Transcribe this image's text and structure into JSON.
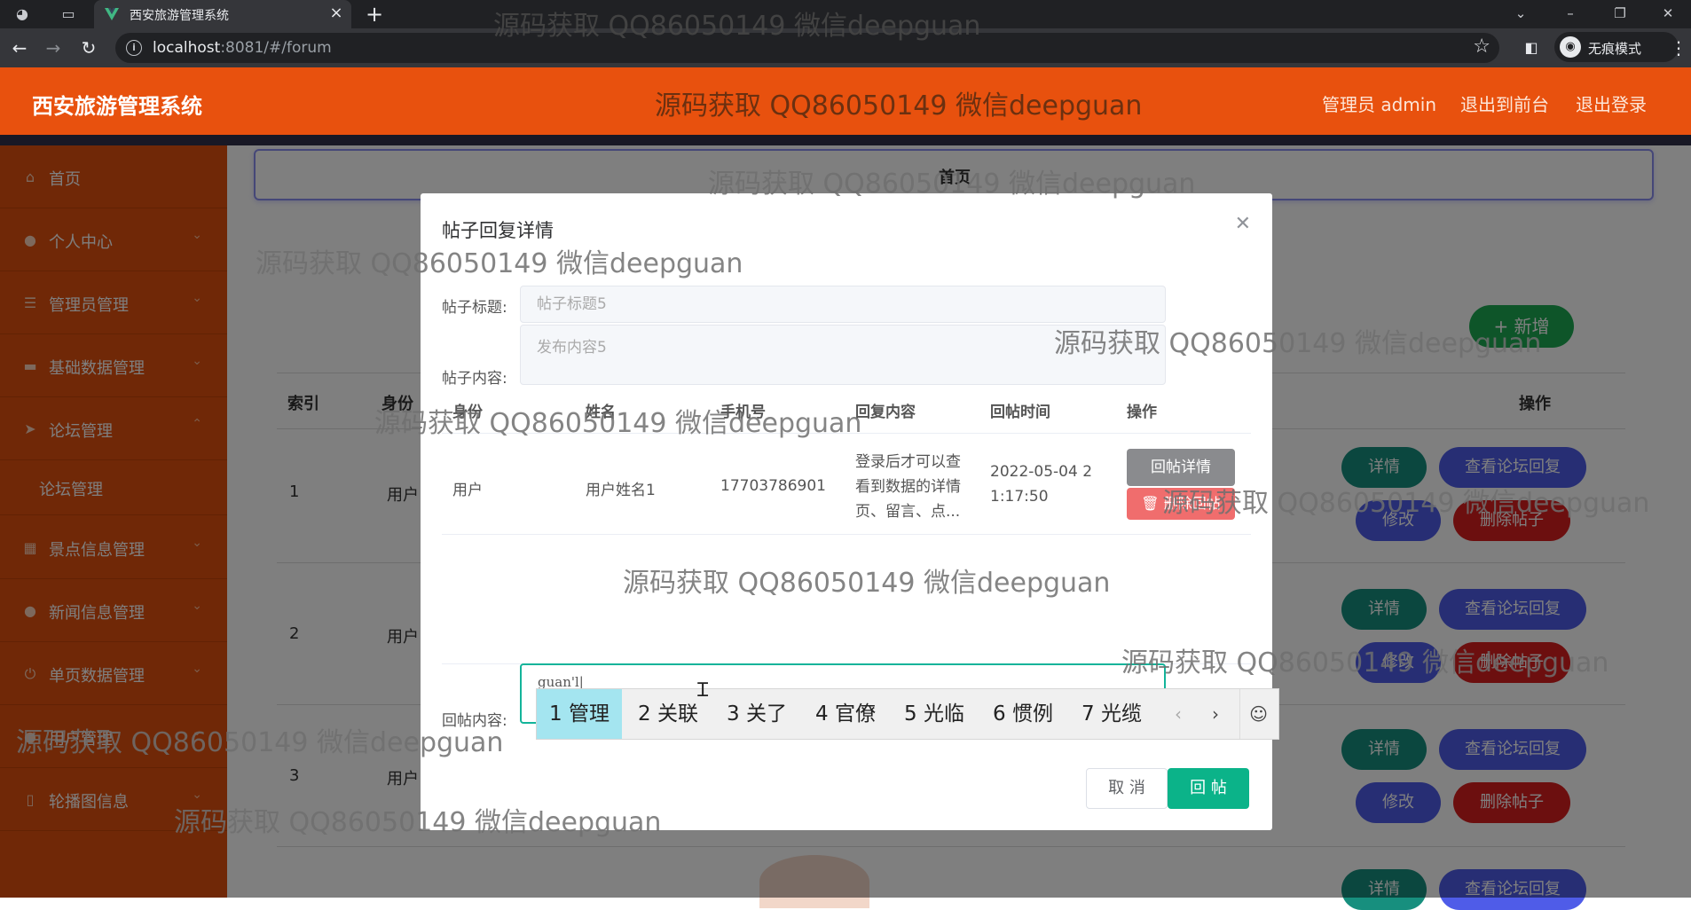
{
  "browser": {
    "tab_title": "西安旅游管理系统",
    "url_host": "localhost",
    "url_rest": ":8081/#/forum",
    "incognito_label": "无痕模式"
  },
  "header": {
    "app_title": "西安旅游管理系统",
    "watermark": "源码获取 QQ86050149 微信deepguan",
    "admin_label": "管理员 admin",
    "exit_front_label": "退出到前台",
    "logout_label": "退出登录"
  },
  "sidebar": {
    "items": [
      {
        "label": "首页",
        "icon": "home-icon"
      },
      {
        "label": "个人中心",
        "icon": "user-icon"
      },
      {
        "label": "管理员管理",
        "icon": "list-icon"
      },
      {
        "label": "基础数据管理",
        "icon": "database-icon"
      },
      {
        "label": "论坛管理",
        "icon": "send-icon"
      },
      {
        "label": "论坛管理",
        "icon": ""
      },
      {
        "label": "景点信息管理",
        "icon": "grid-icon"
      },
      {
        "label": "新闻信息管理",
        "icon": "user-icon"
      },
      {
        "label": "单页数据管理",
        "icon": "power-icon"
      },
      {
        "label": "用户管理",
        "icon": "user-icon"
      },
      {
        "label": "轮播图信息",
        "icon": "phone-icon"
      }
    ]
  },
  "main": {
    "breadcrumb": "首页",
    "add_button": "+ 新增",
    "columns": [
      "索引",
      "身份",
      "操作"
    ],
    "rows": [
      {
        "index": "1",
        "identity": "用户"
      },
      {
        "index": "2",
        "identity": "用户"
      },
      {
        "index": "3",
        "identity": "用户"
      }
    ],
    "actions": {
      "detail": "详情",
      "view_replies": "查看论坛回复",
      "edit": "修改",
      "delete": "删除帖子"
    }
  },
  "dialog": {
    "title": "帖子回复详情",
    "post_title_label": "帖子标题:",
    "post_title_value": "帖子标题5",
    "post_content_label": "帖子内容:",
    "post_content_value": "发布内容5",
    "table_columns": [
      "身份",
      "姓名",
      "手机号",
      "回复内容",
      "回帖时间",
      "操作"
    ],
    "reply_row": {
      "identity": "用户",
      "name": "用户姓名1",
      "phone": "17703786901",
      "content_l1": "登录后才可以查",
      "content_l2": "看到数据的详情",
      "content_l3": "页、留言、点...",
      "time_l1": "2022-05-04 2",
      "time_l2": "1:17:50",
      "btn_detail": "回帖详情",
      "btn_delete": "删除回帖"
    },
    "reply_label": "回帖内容:",
    "reply_value": "guan'l|",
    "cancel_label": "取 消",
    "submit_label": "回 帖"
  },
  "ime": {
    "candidates": [
      "1 管理",
      "2 关联",
      "3 关了",
      "4 官僚",
      "5 光临",
      "6 惯例",
      "7 光缆"
    ]
  },
  "watermark": "源码获取 QQ86050149 微信deepguan"
}
